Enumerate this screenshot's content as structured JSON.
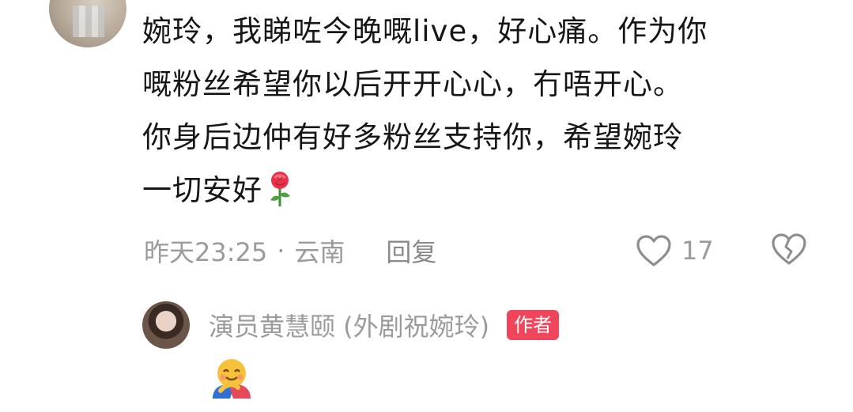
{
  "comment": {
    "lines": [
      "婉玲，我睇咗今晚嘅live，好心痛。作为你",
      "嘅粉丝希望你以后开开心心，冇唔开心。",
      "你身后边仲有好多粉丝支持你，希望婉玲",
      "一切安好"
    ],
    "emoji": "rose-emoji",
    "time": "昨天23:25",
    "separator": "·",
    "location": "云南",
    "reply_label": "回复",
    "like_count": "17"
  },
  "author_reply": {
    "name": "演员黄慧颐 (外剧祝婉玲)",
    "badge": "作者",
    "emoji": "smiling-face-with-hugging-hands-emoji"
  },
  "colors": {
    "text": "#161616",
    "meta": "#9b9b9b",
    "badge": "#f0465b"
  }
}
